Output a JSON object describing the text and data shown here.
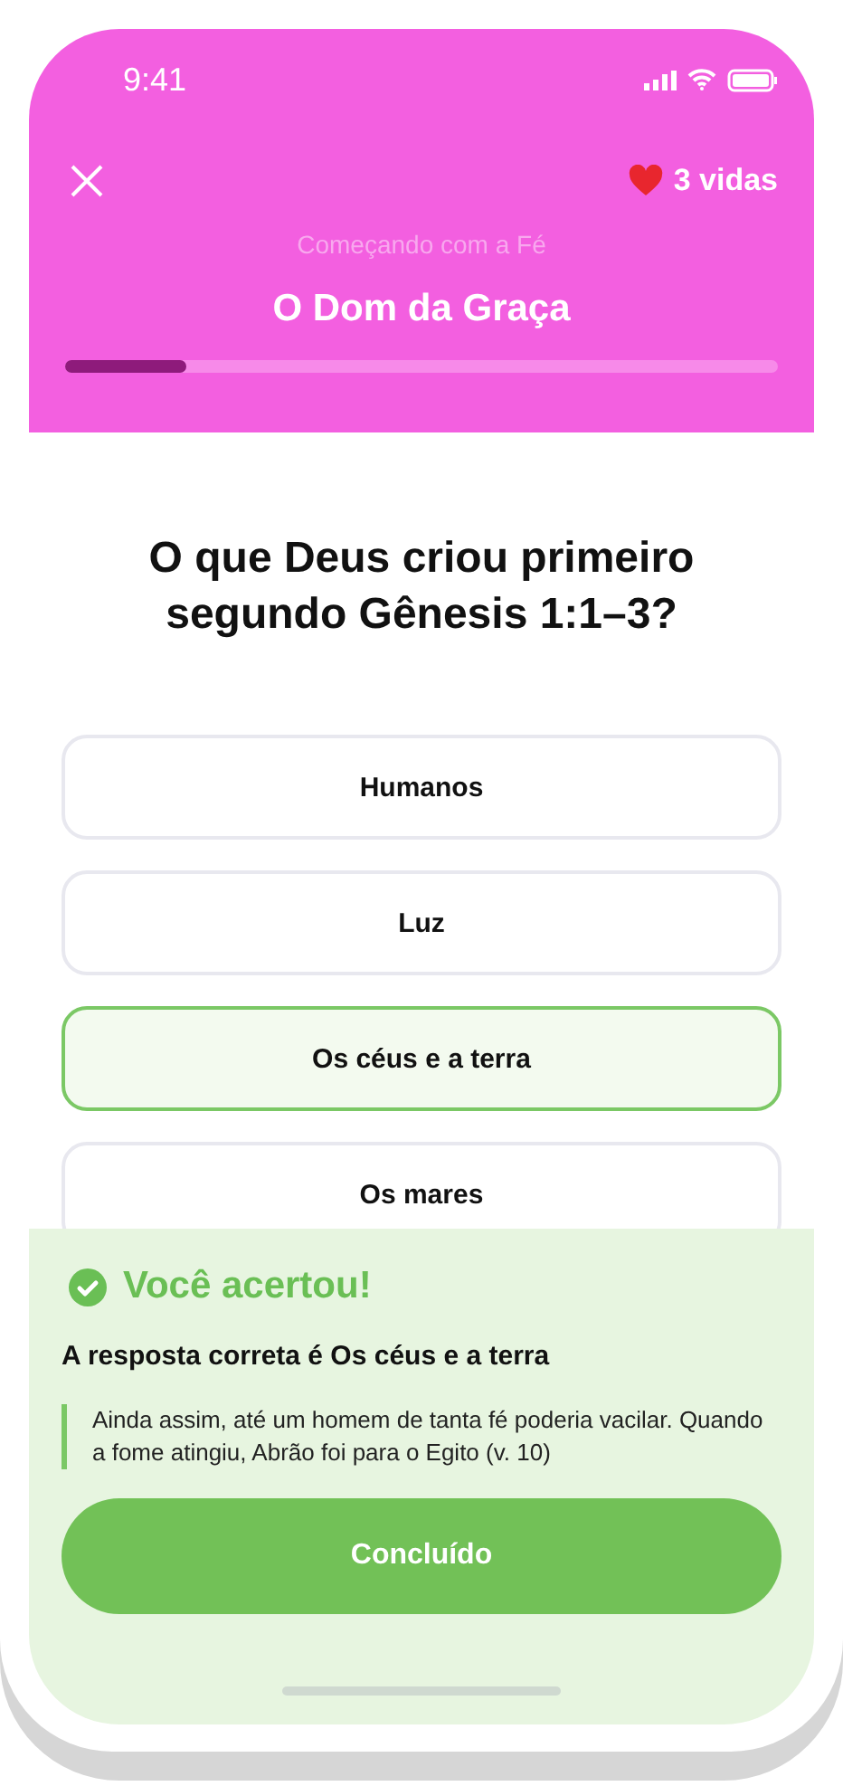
{
  "status_bar": {
    "time": "9:41"
  },
  "header": {
    "lives": "3 vidas",
    "course": "Começando com a Fé",
    "lesson": "O Dom da Graça",
    "progress": {
      "level": 0.17
    }
  },
  "question": "O que Deus criou primeiro segundo Gênesis 1:1–3?",
  "options": [
    {
      "label": "Humanos",
      "selected": false
    },
    {
      "label": "Luz",
      "selected": false
    },
    {
      "label": "Os céus e a terra",
      "selected": true
    },
    {
      "label": "Os mares",
      "selected": false
    }
  ],
  "feedback": {
    "title": "Você acertou!",
    "answer": "A resposta correta é Os céus e a terra",
    "explanation": "Ainda assim, até um homem de tanta fé poderia vacilar. Quando a fome atingiu, Abrão foi para o Egito (v. 10)",
    "button": "Concluído"
  }
}
